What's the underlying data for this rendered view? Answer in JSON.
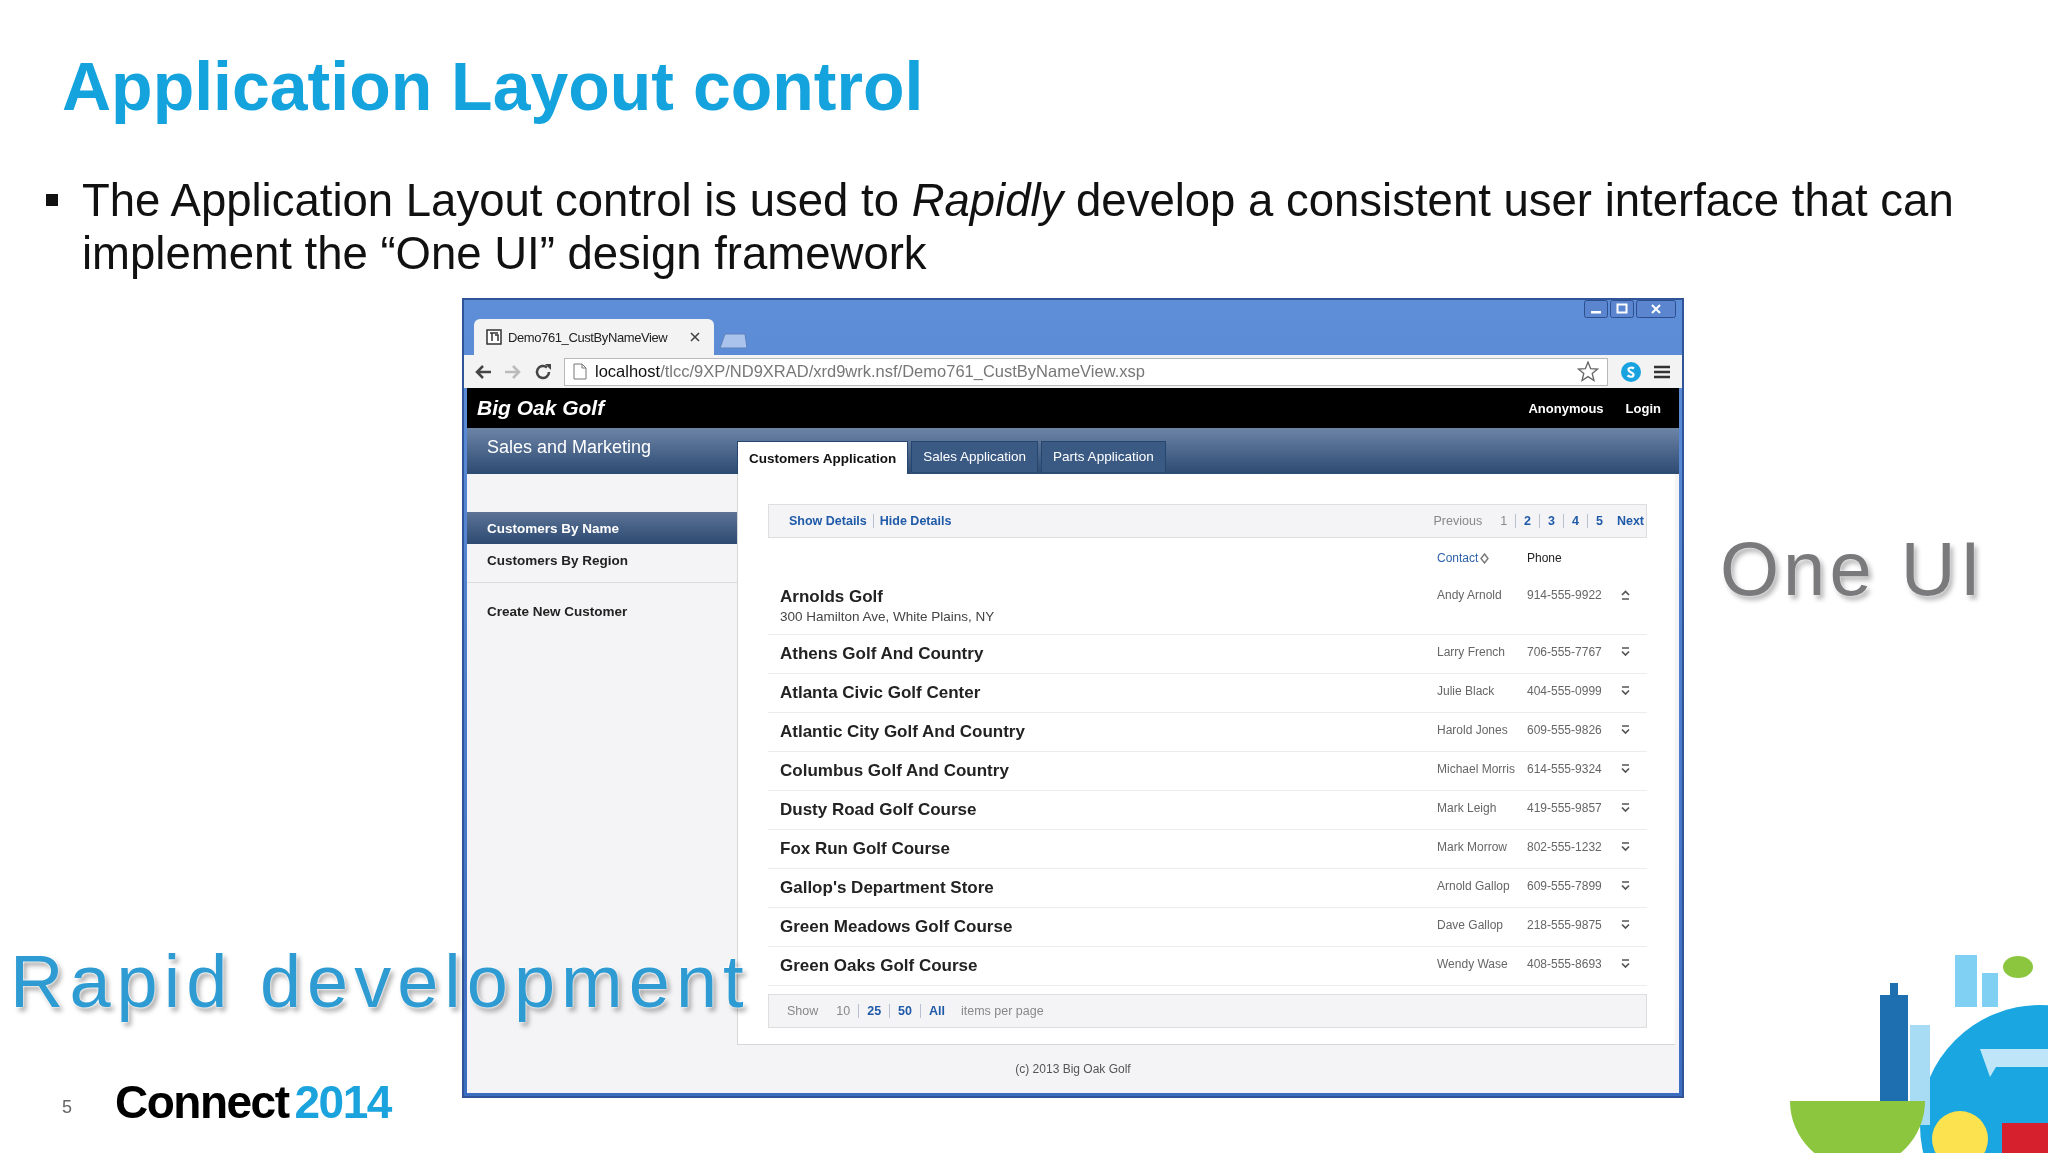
{
  "slide": {
    "title": "Application Layout control",
    "bullet": "The Application Layout control is used to *Rapidly* develop a consistent user interface that can implement the “One UI” design framework",
    "callouts": [
      {
        "text": "Rapid development",
        "kind": "blue"
      },
      {
        "text": "One UI",
        "kind": "gray"
      }
    ],
    "page_number": "5",
    "logo": {
      "word": "Connect",
      "year": "2014"
    }
  },
  "browser": {
    "tab": {
      "title": "Demo761_CustByNameView"
    },
    "url": {
      "host": "localhost",
      "path": "/tlcc/9XP/ND9XRAD/xrd9wrk.nsf/Demo761_CustByNameView.xsp"
    },
    "app": {
      "brand": "Big Oak Golf",
      "user": "Anonymous",
      "login": "Login",
      "subtitle": "Sales and Marketing",
      "tabs": [
        {
          "label": "Customers Application",
          "selected": true
        },
        {
          "label": "Sales Application",
          "selected": false
        },
        {
          "label": "Parts Application",
          "selected": false
        }
      ],
      "sidebar": {
        "views": [
          {
            "label": "Customers By Name",
            "selected": true
          },
          {
            "label": "Customers By Region",
            "selected": false
          }
        ],
        "actions": [
          "Create New Customer"
        ]
      },
      "view": {
        "actions": [
          "Show Details",
          "Hide Details"
        ],
        "pager": {
          "previous": "Previous",
          "pages": [
            {
              "label": "1",
              "selected": true
            },
            {
              "label": "2",
              "selected": false
            },
            {
              "label": "3",
              "selected": false
            },
            {
              "label": "4",
              "selected": false
            },
            {
              "label": "5",
              "selected": false
            }
          ],
          "next": "Next"
        },
        "columns": [
          {
            "label": "Contact",
            "sortable": true
          },
          {
            "label": "Phone",
            "sortable": false
          }
        ],
        "rows": [
          {
            "name": "Arnolds Golf",
            "address": "300 Hamilton Ave, White Plains, NY",
            "contact": "Andy Arnold",
            "phone": "914-555-9922",
            "expanded": true
          },
          {
            "name": "Athens Golf And Country",
            "contact": "Larry French",
            "phone": "706-555-7767",
            "expanded": false
          },
          {
            "name": "Atlanta Civic Golf Center",
            "contact": "Julie Black",
            "phone": "404-555-0999",
            "expanded": false
          },
          {
            "name": "Atlantic City Golf And Country",
            "contact": "Harold Jones",
            "phone": "609-555-9826",
            "expanded": false
          },
          {
            "name": "Columbus Golf And Country",
            "contact": "Michael Morris",
            "phone": "614-555-9324",
            "expanded": false
          },
          {
            "name": "Dusty Road Golf Course",
            "contact": "Mark Leigh",
            "phone": "419-555-9857",
            "expanded": false
          },
          {
            "name": "Fox Run Golf Course",
            "contact": "Mark Morrow",
            "phone": "802-555-1232",
            "expanded": false
          },
          {
            "name": "Gallop's Department Store",
            "contact": "Arnold Gallop",
            "phone": "609-555-7899",
            "expanded": false
          },
          {
            "name": "Green Meadows Golf Course",
            "contact": "Dave Gallop",
            "phone": "218-555-9875",
            "expanded": false
          },
          {
            "name": "Green Oaks Golf Course",
            "contact": "Wendy Wase",
            "phone": "408-555-8693",
            "expanded": false
          }
        ],
        "page_size": {
          "label": "Show",
          "sizes": [
            {
              "label": "10",
              "selected": true
            },
            {
              "label": "25",
              "selected": false
            },
            {
              "label": "50",
              "selected": false
            },
            {
              "label": "All",
              "selected": false
            }
          ],
          "suffix": "items per page"
        }
      },
      "footer": "(c) 2013 Big Oak Golf"
    }
  }
}
